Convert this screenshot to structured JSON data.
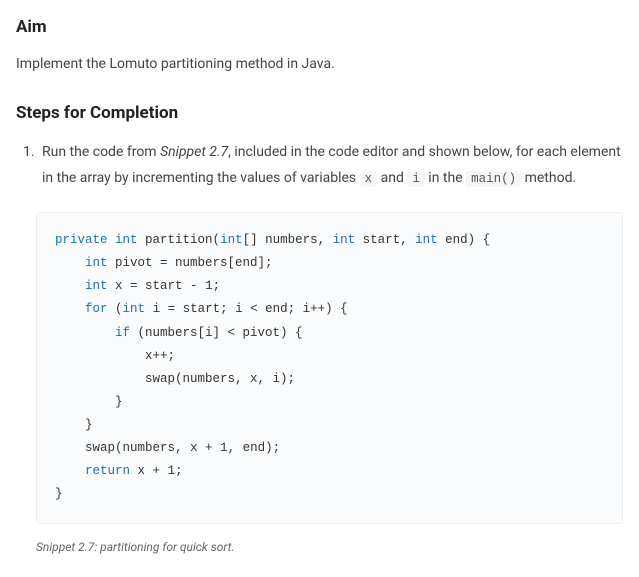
{
  "sections": {
    "aim": {
      "heading": "Aim",
      "text": "Implement the Lomuto partitioning method in Java."
    },
    "steps": {
      "heading": "Steps for Completion",
      "item1": {
        "text_before_ref": "Run the code from ",
        "snippet_ref": "Snippet 2.7",
        "text_after_ref": ", included in the code editor and shown below, for each element in the array by incrementing the values of variables ",
        "var_x": "x",
        "text_between_vars": " and ",
        "var_i": "i",
        "text_before_main": " in the ",
        "fn_main": "main()",
        "text_after_main": " method."
      }
    }
  },
  "code": {
    "kw_private": "private",
    "kw_int": "int",
    "fn_partition": " partition(",
    "arr_decl": "[] numbers, ",
    "param_start": " start, ",
    "param_end": " end) {",
    "line_pivot_a": " pivot = numbers[end];",
    "line_x_a": " x = start - ",
    "num_1": "1",
    "semi": ";",
    "kw_for": "for",
    "for_open": " (",
    "for_decl": " i = start; i < end; i++) {",
    "kw_if": "if",
    "if_cond": " (numbers[i] < pivot) {",
    "line_xpp": "x++;",
    "line_swap1": "swap(numbers, x, i);",
    "close_brace": "}",
    "line_swap2": "swap(numbers, x + ",
    "swap2_tail": ", end);",
    "kw_return": "return",
    "ret_tail": " x + "
  },
  "caption": "Snippet 2.7: partitioning for quick sort."
}
